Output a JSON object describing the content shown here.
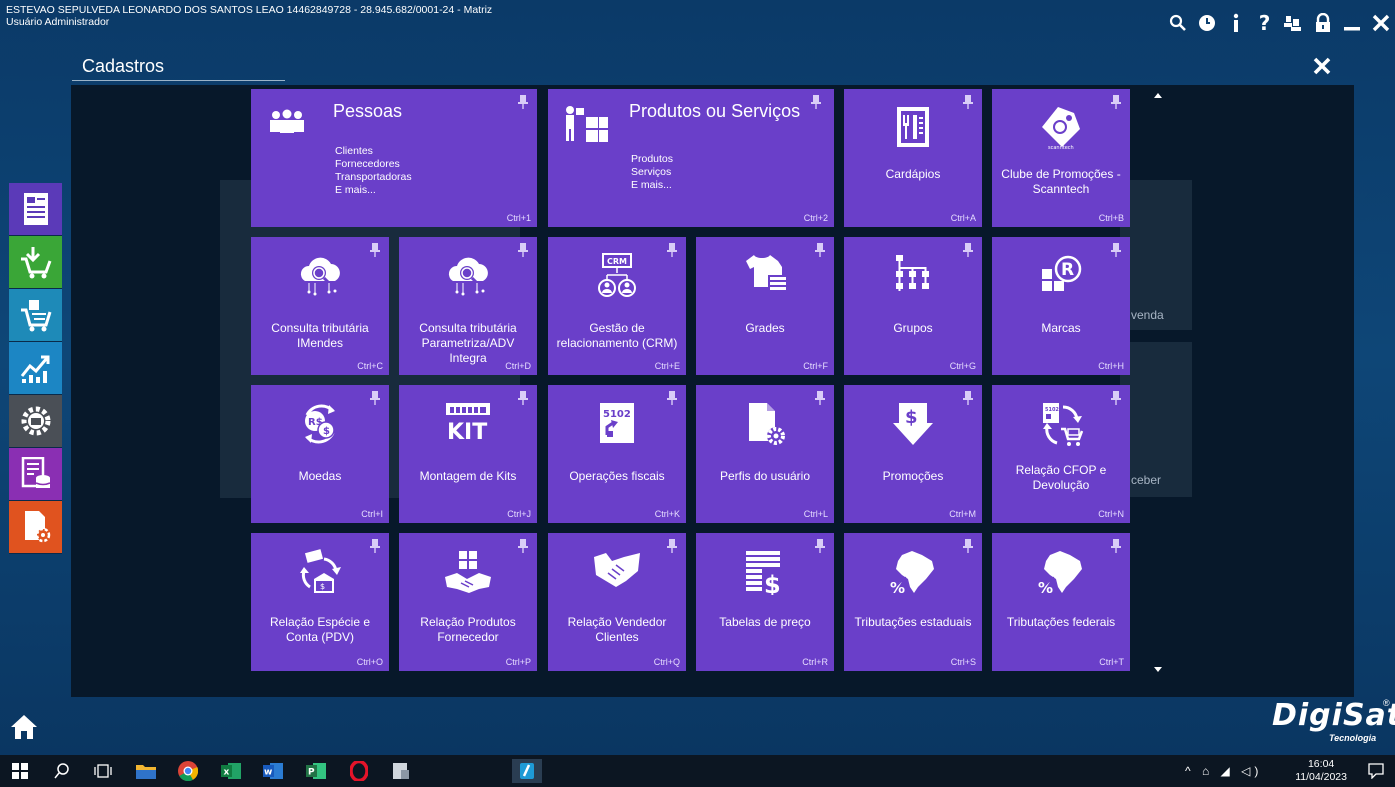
{
  "window": {
    "company_line": "ESTEVAO SEPULVEDA LEONARDO DOS SANTOS LEAO 14462849728 - 28.945.682/0001-24 - Matriz",
    "user_line": "Usuário Administrador",
    "top_icons": [
      "search-icon",
      "clock-icon",
      "info-icon",
      "help-icon",
      "users-icon",
      "lock-icon",
      "minimize-icon",
      "close-icon"
    ]
  },
  "section": {
    "title": "Cadastros"
  },
  "big_tiles": [
    {
      "title": "Pessoas",
      "lines": [
        "Clientes",
        "Fornecedores",
        "Transportadoras",
        "E mais..."
      ],
      "shortcut": "Ctrl+1",
      "icon": "people-icon"
    },
    {
      "title": "Produtos ou Serviços",
      "lines": [
        "Produtos",
        "Serviços",
        "E mais..."
      ],
      "shortcut": "Ctrl+2",
      "icon": "products-icon"
    }
  ],
  "tiles": [
    {
      "label": "Cardápios",
      "shortcut": "Ctrl+A",
      "icon": "menu-card-icon"
    },
    {
      "label": "Clube de Promoções - Scanntech",
      "shortcut": "Ctrl+B",
      "icon": "scanntech-tag-icon",
      "icon_text": "scanntech"
    },
    {
      "label": "Consulta tributária IMendes",
      "shortcut": "Ctrl+C",
      "icon": "cloud-search-icon"
    },
    {
      "label": "Consulta tributária Parametriza/ADV Integra",
      "shortcut": "Ctrl+D",
      "icon": "cloud-search-icon"
    },
    {
      "label": "Gestão de relacionamento (CRM)",
      "shortcut": "Ctrl+E",
      "icon": "crm-icon",
      "icon_text": "CRM"
    },
    {
      "label": "Grades",
      "shortcut": "Ctrl+F",
      "icon": "tshirt-icon"
    },
    {
      "label": "Grupos",
      "shortcut": "Ctrl+G",
      "icon": "hierarchy-icon"
    },
    {
      "label": "Marcas",
      "shortcut": "Ctrl+H",
      "icon": "registered-mark-icon"
    },
    {
      "label": "Moedas",
      "shortcut": "Ctrl+I",
      "icon": "currency-exchange-icon",
      "icon_text": "R$"
    },
    {
      "label": "Montagem de Kits",
      "shortcut": "Ctrl+J",
      "icon": "kit-icon",
      "icon_text": "KIT"
    },
    {
      "label": "Operações fiscais",
      "shortcut": "Ctrl+K",
      "icon": "fiscal-operation-icon",
      "icon_text": "5102"
    },
    {
      "label": "Perfis do usuário",
      "shortcut": "Ctrl+L",
      "icon": "user-profile-gear-icon"
    },
    {
      "label": "Promoções",
      "shortcut": "Ctrl+M",
      "icon": "promotion-down-icon"
    },
    {
      "label": "Relação CFOP e Devolução",
      "shortcut": "Ctrl+N",
      "icon": "cfop-return-icon",
      "icon_text": "5102"
    },
    {
      "label": "Relação Espécie e Conta (PDV)",
      "shortcut": "Ctrl+O",
      "icon": "money-bank-icon"
    },
    {
      "label": "Relação Produtos Fornecedor",
      "shortcut": "Ctrl+P",
      "icon": "handshake-boxes-icon"
    },
    {
      "label": "Relação Vendedor Clientes",
      "shortcut": "Ctrl+Q",
      "icon": "handshake-icon"
    },
    {
      "label": "Tabelas de preço",
      "shortcut": "Ctrl+R",
      "icon": "price-table-icon"
    },
    {
      "label": "Tributações estaduais",
      "shortcut": "Ctrl+S",
      "icon": "brazil-map-percent-icon"
    },
    {
      "label": "Tributações federais",
      "shortcut": "Ctrl+T",
      "icon": "brazil-map-percent-icon"
    }
  ],
  "dock": [
    "document-icon",
    "cart-download-icon",
    "cart-add-icon",
    "chart-growth-icon",
    "gear-settings-icon",
    "report-database-icon",
    "document-settings-icon"
  ],
  "background_ghost": {
    "venda": "venda",
    "receber": "ceber"
  },
  "logo": {
    "name": "DigiSat",
    "sub": "Tecnologia",
    "mark": "®"
  },
  "taskbar": {
    "time": "16:04",
    "date": "11/04/2023",
    "apps": [
      "windows-start-icon",
      "search-icon",
      "task-view-icon",
      "file-explorer-icon",
      "chrome-icon",
      "excel-icon",
      "word-icon",
      "project-icon",
      "opera-icon",
      "app-icon",
      "digisat-app-icon"
    ]
  },
  "colors": {
    "tile": "#6a3fc9",
    "background": "#0e4677",
    "stage": "#07182a"
  }
}
